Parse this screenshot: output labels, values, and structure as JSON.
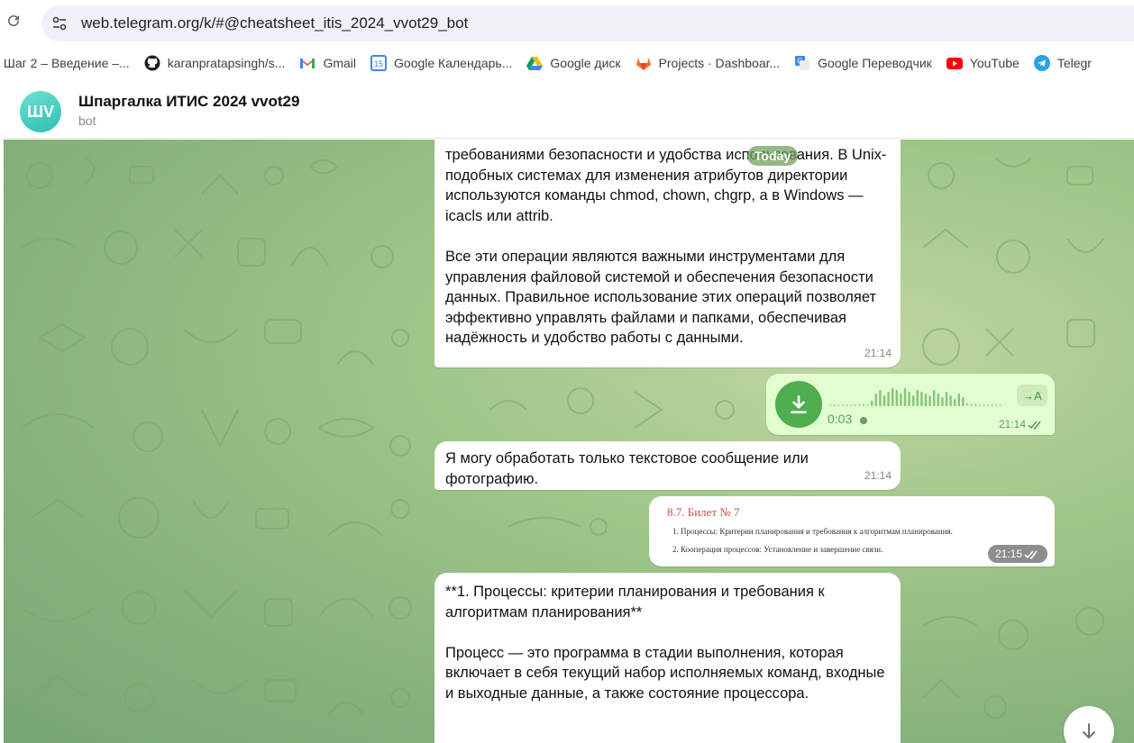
{
  "browser": {
    "url": "web.telegram.org/k/#@cheatsheet_itis_2024_vvot29_bot",
    "bookmarks": [
      {
        "label": "Шаг 2 – Введение –...",
        "icon": "none"
      },
      {
        "label": "karanpratapsingh/s...",
        "icon": "github-icon"
      },
      {
        "label": "Gmail",
        "icon": "gmail-icon"
      },
      {
        "label": "Google Календарь...",
        "icon": "calendar-icon"
      },
      {
        "label": "Google диск",
        "icon": "drive-icon"
      },
      {
        "label": "Projects · Dashboar...",
        "icon": "gitlab-icon"
      },
      {
        "label": "Google Переводчик",
        "icon": "translate-icon"
      },
      {
        "label": "YouTube",
        "icon": "youtube-icon"
      },
      {
        "label": "Telegr",
        "icon": "telegram-icon"
      }
    ]
  },
  "chat": {
    "avatar_initials": "ШV",
    "title": "Шпаргалка ИТИС 2024 vvot29",
    "subtitle": "bot",
    "date_pill": "Today"
  },
  "messages": [
    {
      "id": "m1",
      "text": "требованиями безопасности и удобства использования. В Unix-подобных системах для изменения атрибутов директории используются команды chmod, chown, chgrp, а в Windows — icacls или attrib.\n\nВсе эти операции являются важными инструментами для управления файловой системой и обеспечения безопасности данных. Правильное использование этих операций позволяет эффективно управлять файлами и папками, обеспечивая надёжность и удобство работы с данными.",
      "time": "21:14"
    },
    {
      "id": "m2",
      "voice_duration": "0:03",
      "transcribe_label": "→A",
      "time": "21:14",
      "status": "read"
    },
    {
      "id": "m3",
      "text": "Я могу обработать только текстовое сообщение или фотографию.",
      "time": "21:14"
    },
    {
      "id": "m4",
      "photo_title": "8.7. Билет № 7",
      "photo_line1": "1. Процессы: Критерии планирования и требования к алгоритмам планирования.",
      "photo_line2": "2. Кооперация процессов: Установление и завершение связи.",
      "time": "21:15",
      "status": "read"
    },
    {
      "id": "m5",
      "text": "**1. Процессы: критерии планирования и требования к алгоритмам планирования**\n\nПроцесс — это программа в стадии выполнения, которая включает в себя текущий набор исполняемых команд, входные и выходные данные, а также состояние процессора."
    }
  ],
  "colors": {
    "accent": "#4fae4e",
    "outgoing_bubble": "#e2fdd0",
    "background": "#9cc486"
  }
}
